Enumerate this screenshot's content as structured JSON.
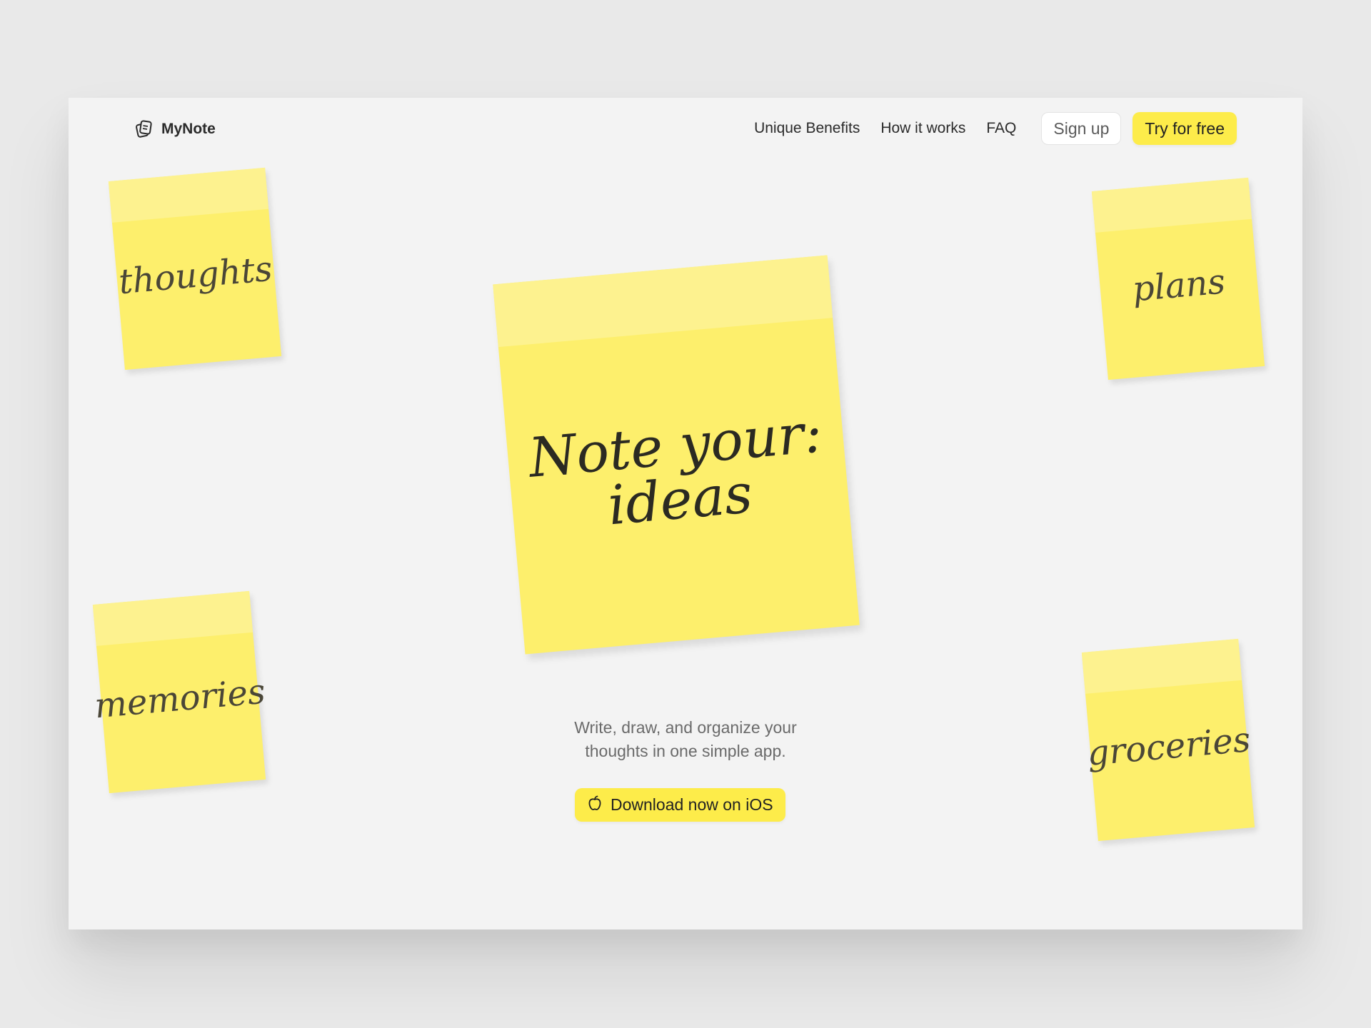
{
  "brand": {
    "name": "MyNote",
    "icon": "notes-logo-icon"
  },
  "nav": {
    "links": [
      "Unique Benefits",
      "How it works",
      "FAQ"
    ],
    "signup_label": "Sign up",
    "try_label": "Try for free"
  },
  "notes": {
    "main_line1": "Note your:",
    "main_line2": "ideas",
    "thoughts": "thoughts",
    "plans": "plans",
    "memories": "memories",
    "groceries": "groceries"
  },
  "hero": {
    "subtitle_line1": "Write, draw, and organize your",
    "subtitle_line2": "thoughts in one simple app.",
    "download_label": "Download now on iOS",
    "download_icon": "apple-icon"
  },
  "colors": {
    "accent": "#fdec4a",
    "note": "#fdef6c",
    "note_strip": "#fdf28f",
    "background": "#f3f3f3"
  }
}
